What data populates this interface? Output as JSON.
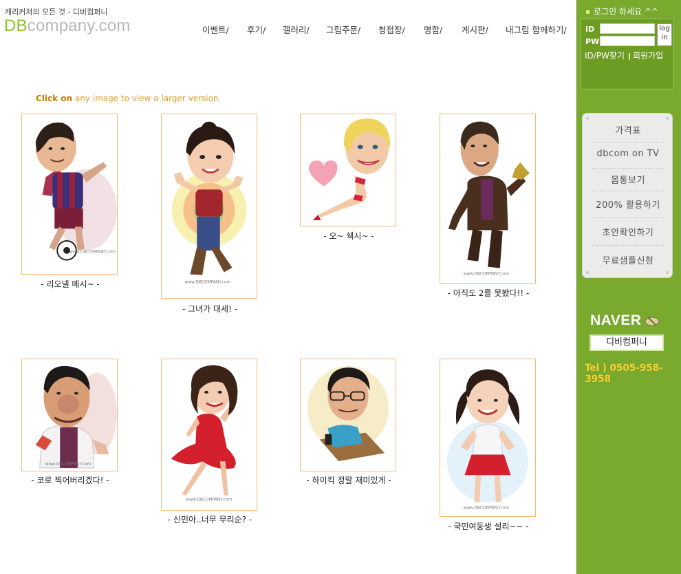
{
  "header": {
    "tagline": "캐리커쳐의 모든 것 - 디비컴퍼니",
    "logo_prefix": "DB",
    "logo_suffix": "company.com",
    "nav": [
      "이벤트/",
      "후기/",
      "갤러리/",
      "그림주문/",
      "청첩장/",
      "명함/",
      "게시판/",
      "내그림 함께하기/"
    ]
  },
  "hint": {
    "bold": "Click on",
    "text": " any image to view a larger version."
  },
  "gallery": [
    {
      "caption": "- 리오넬 메시~ -",
      "watermark": "www.DBCOMPANY.com"
    },
    {
      "caption": "- 그녀가 대세! -",
      "watermark": "www.DBCOMPANY.com"
    },
    {
      "caption": "- 오~ 쉑시~ -",
      "watermark": ""
    },
    {
      "caption": "- 아직도 2를 못봤다!! -",
      "watermark": "www.DBCOMPANY.com"
    },
    {
      "caption": "- 코로 찍어버리겠다! -",
      "watermark": "www.DBCOMPANY.com"
    },
    {
      "caption": "- 신민아..너무 무리순? -",
      "watermark": "www.DBCOMPANY.com"
    },
    {
      "caption": "- 하이킥 정말 재미있게 -",
      "watermark": ""
    },
    {
      "caption": "- 국민여동생 설리~~ -",
      "watermark": "www.DBCOMPANY.com"
    }
  ],
  "sidebar": {
    "login_title": "로그인 하세요 ^^",
    "id_label": "ID",
    "pw_label": "PW",
    "login_btn_top": "log",
    "login_btn_bottom": "in",
    "find_link": "ID/PW찾기",
    "join_link": "회원가입",
    "menu": [
      "가격표",
      "dbcom on TV",
      "몸통보기",
      "200% 활용하기",
      "초안확인하기",
      "무료샘플신청"
    ],
    "naver": "NAVER",
    "naver_search": "디비컴퍼니",
    "tel": "Tel ) 0505-958-3958"
  },
  "colors": {
    "accent_green": "#8cc21f",
    "sidebar_green": "#79a92d",
    "frame_orange": "#f0b974",
    "hint_orange": "#d98a10",
    "tel_yellow": "#f2d838"
  }
}
